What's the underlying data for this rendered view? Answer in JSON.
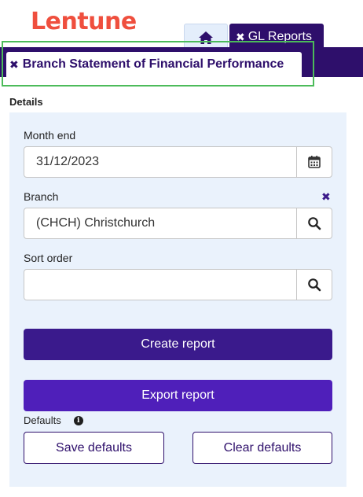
{
  "app": {
    "logo": "Lentune"
  },
  "tabs": {
    "home_icon": "home-icon",
    "gl_reports_label": "GL Reports",
    "active_label": "Branch Statement of Financial Performance",
    "close_glyph": "✖"
  },
  "details": {
    "heading": "Details",
    "month_end": {
      "label": "Month end",
      "value": "31/12/2023",
      "icon": "calendar-icon"
    },
    "branch": {
      "label": "Branch",
      "value": "(CHCH) Christchurch",
      "icon": "search-icon",
      "clear_glyph": "✖"
    },
    "sort_order": {
      "label": "Sort order",
      "value": "",
      "icon": "search-icon"
    }
  },
  "actions": {
    "create_label": "Create report",
    "export_label": "Export report"
  },
  "defaults": {
    "label": "Defaults",
    "info_glyph": "i",
    "save_label": "Save defaults",
    "clear_label": "Clear defaults"
  },
  "colors": {
    "brand": "#ef4f3e",
    "nav": "#2e0f6b",
    "primary": "#3a1a8c",
    "panel": "#eaf2fc",
    "focus": "#4cbb5a"
  }
}
